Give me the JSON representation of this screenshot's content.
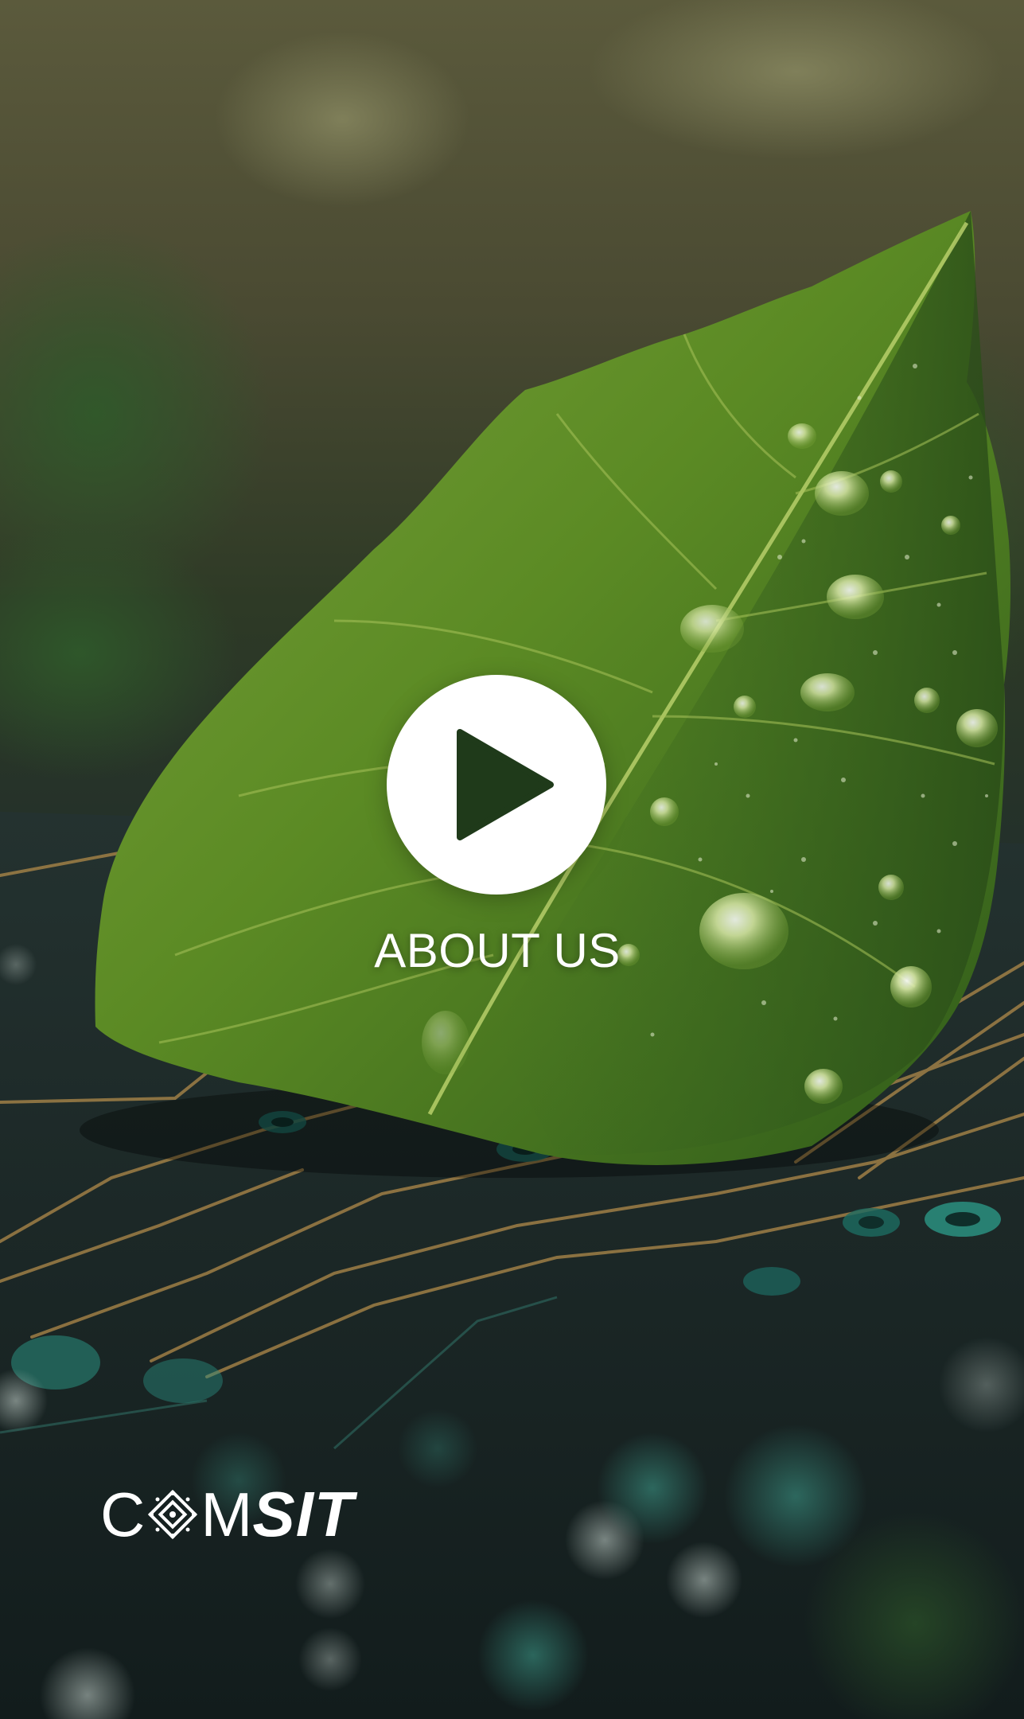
{
  "cta": {
    "label": "ABOUT US",
    "play_icon": "play-icon"
  },
  "brand": {
    "c": "C",
    "m": "M",
    "sit": "SIT",
    "mark_icon": "chip-icon"
  },
  "colors": {
    "leaf": "#5e8a22",
    "board": "#1a2624",
    "trace": "#b08a4a",
    "button": "#ffffff",
    "play": "#1f3a1a"
  }
}
